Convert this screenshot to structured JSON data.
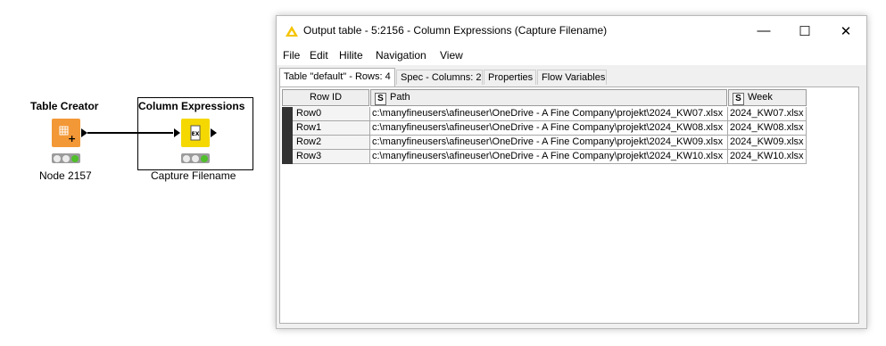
{
  "workflow": {
    "nodes": [
      {
        "title": "Table Creator",
        "label": "Node 2157",
        "icon": "table-grid-icon",
        "color": "#f39836"
      },
      {
        "title": "Column Expressions",
        "label": "Capture Filename",
        "icon": "expression-icon",
        "icon_text": "EX",
        "color": "#f5d800"
      }
    ]
  },
  "window": {
    "title": "Output table - 5:2156 - Column Expressions (Capture Filename)",
    "controls": {
      "minimize": "—",
      "maximize": "☐",
      "close": "✕"
    },
    "menu": [
      "File",
      "Edit",
      "Hilite",
      "Navigation",
      "View"
    ],
    "tabs": [
      "Table \"default\" - Rows: 4",
      "Spec - Columns: 2",
      "Properties",
      "Flow Variables"
    ],
    "table": {
      "row_id_header": "Row ID",
      "columns": [
        {
          "type": "S",
          "name": "Path"
        },
        {
          "type": "S",
          "name": "Week"
        }
      ],
      "rows": [
        {
          "id": "Row0",
          "path": "c:\\manyfineusers\\afineuser\\OneDrive - A Fine Company\\projekt\\2024_KW07.xlsx",
          "week": "2024_KW07.xlsx"
        },
        {
          "id": "Row1",
          "path": "c:\\manyfineusers\\afineuser\\OneDrive - A Fine Company\\projekt\\2024_KW08.xlsx",
          "week": "2024_KW08.xlsx"
        },
        {
          "id": "Row2",
          "path": "c:\\manyfineusers\\afineuser\\OneDrive - A Fine Company\\projekt\\2024_KW09.xlsx",
          "week": "2024_KW09.xlsx"
        },
        {
          "id": "Row3",
          "path": "c:\\manyfineusers\\afineuser\\OneDrive - A Fine Company\\projekt\\2024_KW10.xlsx",
          "week": "2024_KW10.xlsx"
        }
      ]
    }
  }
}
